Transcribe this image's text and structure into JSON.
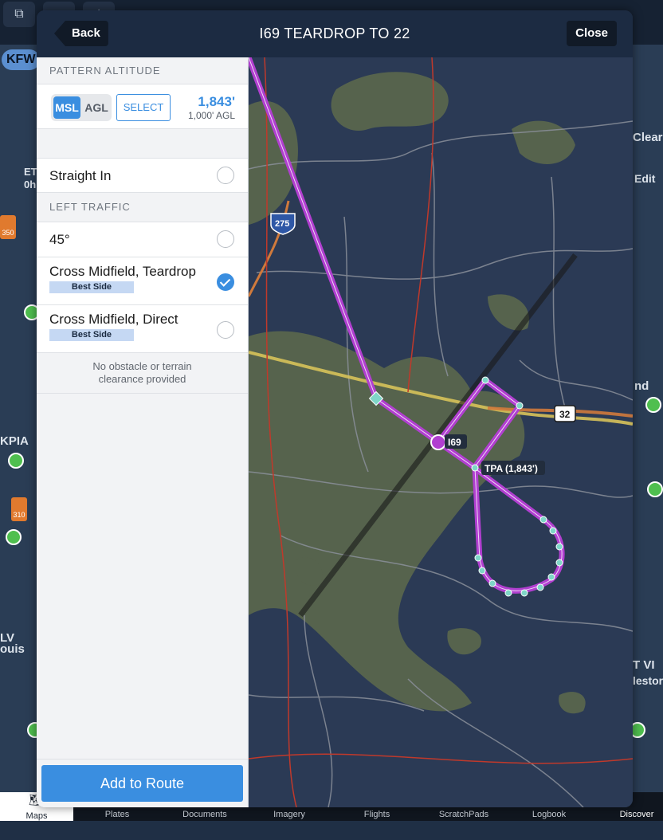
{
  "background": {
    "airport_pill": "KFW",
    "left_labels": [
      "ET",
      "0h",
      "KPIA",
      "LV",
      "ouis"
    ],
    "right_labels": [
      "Clear",
      "Edit",
      "nd",
      "T VI",
      "lestor"
    ],
    "warn_values": [
      "350",
      "310"
    ],
    "tabs": [
      "Maps",
      "Plates",
      "Documents",
      "Imagery",
      "Flights",
      "ScratchPads",
      "Logbook",
      "Discover"
    ]
  },
  "modal": {
    "title": "I69 TEARDROP TO 22",
    "back_label": "Back",
    "close_label": "Close"
  },
  "panel": {
    "pattern_altitude_header": "PATTERN ALTITUDE",
    "msl_label": "MSL",
    "agl_label": "AGL",
    "select_label": "SELECT",
    "altitude_value": "1,843'",
    "altitude_agl": "1,000' AGL",
    "straight_in_label": "Straight In",
    "left_traffic_header": "LEFT TRAFFIC",
    "options": [
      {
        "label": "45°",
        "badge": "",
        "checked": false
      },
      {
        "label": "Cross Midfield, Teardrop",
        "badge": "Best Side",
        "checked": true
      },
      {
        "label": "Cross Midfield, Direct",
        "badge": "Best Side",
        "checked": false
      }
    ],
    "note_line1": "No obstacle or terrain",
    "note_line2": "clearance provided",
    "add_button": "Add to Route"
  },
  "map": {
    "airport_label": "I69",
    "tpa_label": "TPA (1,843')",
    "highway_shield": "275",
    "route_shield": "32",
    "colors": {
      "route": "#b13fd0",
      "terrain": "#5e6b4c",
      "water_bg": "#2b3a55",
      "road": "#8a8f9a",
      "highway_yellow": "#d7c25a",
      "highway_orange": "#d07a3c",
      "boundary_red": "#c0392b"
    }
  }
}
